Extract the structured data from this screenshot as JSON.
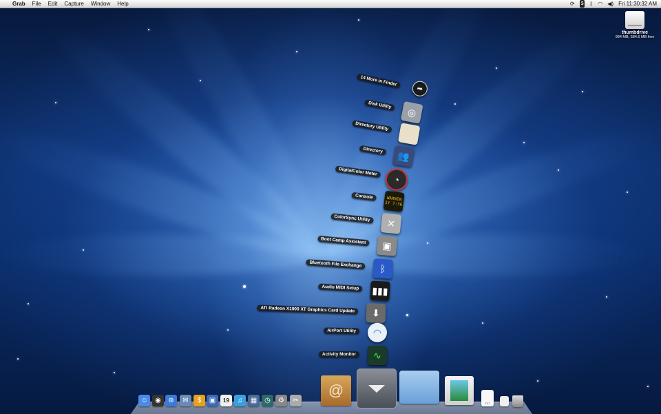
{
  "menubar": {
    "apple_icon": "apple-icon",
    "app_name": "Grab",
    "menus": [
      "File",
      "Edit",
      "Capture",
      "Window",
      "Help"
    ],
    "status_icons": [
      "sync-icon",
      "dollar-icon",
      "bluetooth-icon",
      "wifi-icon",
      "volume-icon"
    ],
    "clock": "Fri 11:30:32 AM"
  },
  "desktop": {
    "drive": {
      "name": "thumbdrive",
      "size": "984 MB, 584.6 MB free",
      "icon": "drive-icon"
    }
  },
  "fan": {
    "items": [
      {
        "label": "14 More in Finder",
        "icon": "arrow-right-icon",
        "color": "#1a1a1a"
      },
      {
        "label": "Disk Utility",
        "icon": "disk-utility-icon",
        "color": "#9aa0a8"
      },
      {
        "label": "Directory Utility",
        "icon": "map-icon",
        "color": "#e8e0c8"
      },
      {
        "label": "Directory",
        "icon": "people-icon",
        "color": "#3a4a7a"
      },
      {
        "label": "DigitalColor Meter",
        "icon": "meter-icon",
        "color": "#2a2a2a"
      },
      {
        "label": "Console",
        "icon": "console-icon",
        "color": "#1a1a0a"
      },
      {
        "label": "ColorSync Utility",
        "icon": "wrench-icon",
        "color": "#b0b0b0"
      },
      {
        "label": "Boot Camp Assistant",
        "icon": "bootcamp-icon",
        "color": "#8a8a8a"
      },
      {
        "label": "Bluetooth File Exchange",
        "icon": "bluetooth-icon",
        "color": "#2a5ac8"
      },
      {
        "label": "Audio MIDI Setup",
        "icon": "piano-icon",
        "color": "#1a1a1a"
      },
      {
        "label": "ATI Radeon X1900 XT Graphics Card Update",
        "icon": "download-icon",
        "color": "#6a6a6a"
      },
      {
        "label": "AirPort Utility",
        "icon": "wifi-icon",
        "color": "#e8f0f8"
      },
      {
        "label": "Activity Monitor",
        "icon": "monitor-icon",
        "color": "#1a3a2a"
      }
    ],
    "console_text": "WARNIN 1Y 7:36",
    "toggle_icon": "chevron-down-icon"
  },
  "dock": {
    "apps": [
      {
        "name": "finder-icon",
        "color": "#4a8ae8"
      },
      {
        "name": "dashboard-icon",
        "color": "#333"
      },
      {
        "name": "safari-icon",
        "color": "#3a7ad8"
      },
      {
        "name": "mail-icon",
        "color": "#6a8ab8"
      },
      {
        "name": "dollar-icon",
        "color": "#e8a020"
      },
      {
        "name": "preview-icon",
        "color": "#3a6ab8"
      },
      {
        "name": "calendar-icon",
        "color": "#f0f0f0"
      },
      {
        "name": "itunes-icon",
        "color": "#3aa0e0"
      },
      {
        "name": "spaces-icon",
        "color": "#4a6a9a"
      },
      {
        "name": "time-machine-icon",
        "color": "#2a6a6a"
      },
      {
        "name": "system-preferences-icon",
        "color": "#888"
      },
      {
        "name": "utility-icon",
        "color": "#aaa"
      }
    ],
    "calendar_day": "19",
    "stacks": [
      "address-book-icon",
      "folder-icon",
      "preview-stack-icon",
      "text-file-icon",
      "document-icon",
      "trash-icon"
    ],
    "text_file_label": "TXT"
  }
}
